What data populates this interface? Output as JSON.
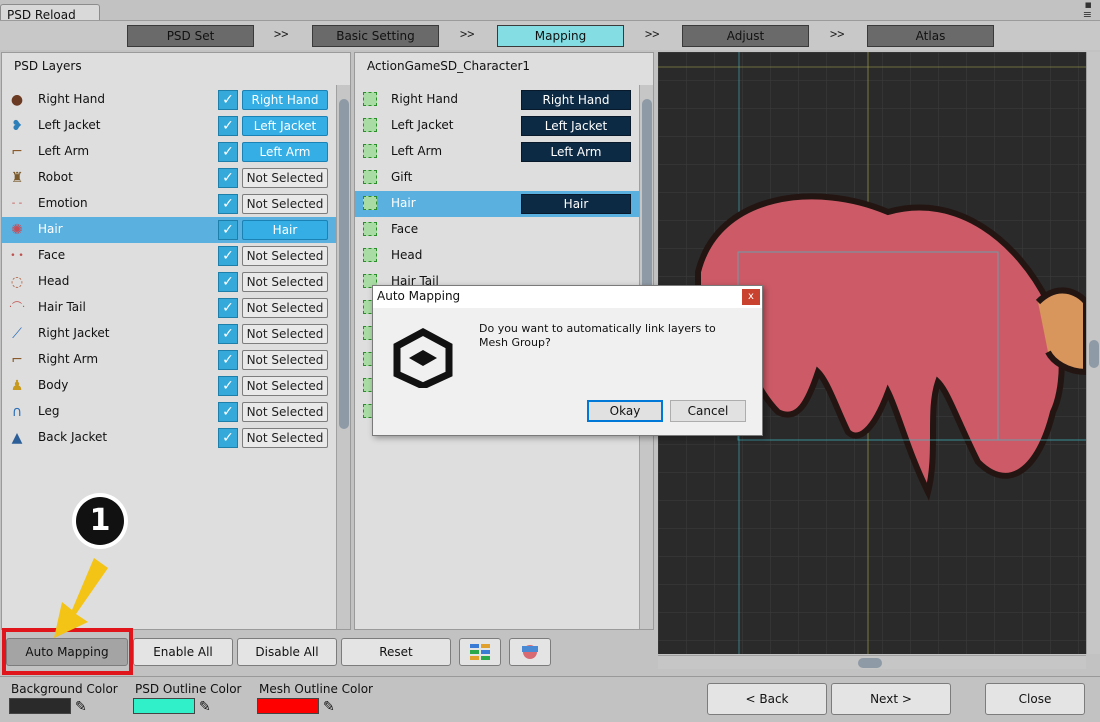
{
  "window": {
    "title": "PSD Reload"
  },
  "steps": [
    {
      "label": "PSD Set",
      "active": false
    },
    {
      "label": "Basic Setting",
      "active": false
    },
    {
      "label": "Mapping",
      "active": true
    },
    {
      "label": "Adjust",
      "active": false
    },
    {
      "label": "Atlas",
      "active": false
    }
  ],
  "step_separator": ">>",
  "psd_panel": {
    "title": "PSD Layers",
    "layers": [
      {
        "name": "Right Hand",
        "checked": true,
        "mapped": "Right Hand",
        "on": true
      },
      {
        "name": "Left Jacket",
        "checked": true,
        "mapped": "Left Jacket",
        "on": true
      },
      {
        "name": "Left Arm",
        "checked": true,
        "mapped": "Left Arm",
        "on": true
      },
      {
        "name": "Robot",
        "checked": true,
        "mapped": "Not Selected",
        "on": false
      },
      {
        "name": "Emotion",
        "checked": true,
        "mapped": "Not Selected",
        "on": false
      },
      {
        "name": "Hair",
        "checked": true,
        "mapped": "Hair",
        "on": true
      },
      {
        "name": "Face",
        "checked": true,
        "mapped": "Not Selected",
        "on": false
      },
      {
        "name": "Head",
        "checked": true,
        "mapped": "Not Selected",
        "on": false
      },
      {
        "name": "Hair Tail",
        "checked": true,
        "mapped": "Not Selected",
        "on": false
      },
      {
        "name": "Right Jacket",
        "checked": true,
        "mapped": "Not Selected",
        "on": false
      },
      {
        "name": "Right Arm",
        "checked": true,
        "mapped": "Not Selected",
        "on": false
      },
      {
        "name": "Body",
        "checked": true,
        "mapped": "Not Selected",
        "on": false
      },
      {
        "name": "Leg",
        "checked": true,
        "mapped": "Not Selected",
        "on": false
      },
      {
        "name": "Back Jacket",
        "checked": true,
        "mapped": "Not Selected",
        "on": false
      }
    ]
  },
  "mesh_panel": {
    "title": "ActionGameSD_Character1",
    "items": [
      {
        "name": "Right Hand",
        "linked": "Right Hand"
      },
      {
        "name": "Left Jacket",
        "linked": "Left Jacket"
      },
      {
        "name": "Left Arm",
        "linked": "Left Arm"
      },
      {
        "name": "Gift",
        "linked": ""
      },
      {
        "name": "Hair",
        "linked": "Hair"
      },
      {
        "name": "Face",
        "linked": ""
      },
      {
        "name": "Head",
        "linked": ""
      },
      {
        "name": "Hair Tail",
        "linked": ""
      }
    ]
  },
  "toolbar": {
    "auto_mapping": "Auto Mapping",
    "enable_all": "Enable All",
    "disable_all": "Disable All",
    "reset": "Reset"
  },
  "annotation": {
    "number": "1"
  },
  "bottom": {
    "bg_color_label": "Background Color",
    "psd_outline_label": "PSD Outline Color",
    "mesh_outline_label": "Mesh Outline Color",
    "bg_color": "#2a2a2a",
    "psd_outline_color": "#2ff0c8",
    "mesh_outline_color": "#ff0000",
    "back": "< Back",
    "next": "Next >",
    "close": "Close"
  },
  "dialog": {
    "title": "Auto Mapping",
    "close_glyph": "x",
    "message": "Do you want to automatically link layers to Mesh Group?",
    "ok": "Okay",
    "cancel": "Cancel"
  },
  "colors": {
    "active_step": "#84dde2",
    "selection": "#5ab0df",
    "mapped_tag": "#34aee5",
    "mesh_tag": "#0d2a44",
    "annotation_red": "#e0141b",
    "annotation_arrow": "#f3c316"
  }
}
